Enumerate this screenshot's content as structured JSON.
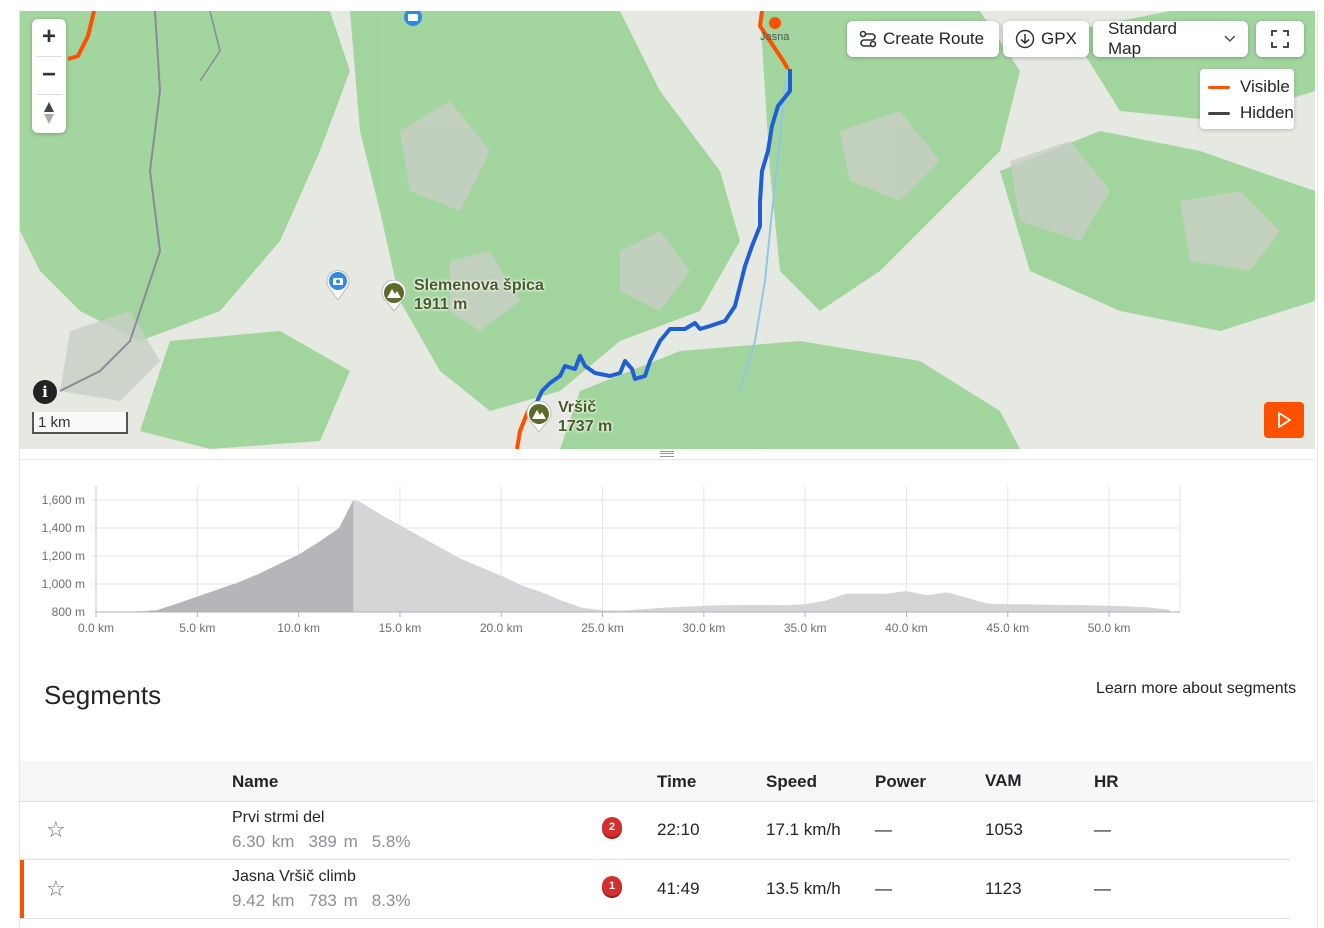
{
  "map": {
    "zoom_in": "+",
    "zoom_out": "−",
    "toolbar": {
      "create_route": "Create Route",
      "gpx": "GPX",
      "map_style": "Standard Map"
    },
    "legend": [
      {
        "label": "Visible",
        "color": "#fc5200"
      },
      {
        "label": "Hidden",
        "color": "#444444"
      }
    ],
    "scale_label": "1 km",
    "places": [
      {
        "name": "Slemenova špica",
        "elevation": "1911 m"
      },
      {
        "name": "Vršič",
        "elevation": "1737 m"
      },
      {
        "name": "Jasna"
      }
    ],
    "route_color": "#1f5fd6",
    "icons": [
      "plus-icon",
      "minus-icon",
      "compass-icon",
      "route-icon",
      "download-icon",
      "chevron-down-icon",
      "fullscreen-icon",
      "info-icon",
      "play-icon",
      "camera-icon",
      "mountain-icon"
    ]
  },
  "elevation": {
    "y_ticks": [
      "1,600 m",
      "1,400 m",
      "1,200 m",
      "1,000 m",
      "800 m"
    ],
    "x_ticks": [
      "0.0 km",
      "5.0 km",
      "10.0 km",
      "15.0 km",
      "20.0 km",
      "25.0 km",
      "30.0 km",
      "35.0 km",
      "40.0 km",
      "45.0 km",
      "50.0 km"
    ]
  },
  "chart_data": {
    "type": "area",
    "x": [
      0,
      1,
      2,
      3,
      4,
      5,
      6,
      7,
      8,
      9,
      10,
      11,
      12,
      12.7,
      13,
      14,
      15,
      16,
      17,
      18,
      19,
      20,
      21,
      22,
      23,
      24,
      25,
      26,
      27,
      28,
      29,
      30,
      31,
      32,
      33,
      34,
      35,
      36,
      37,
      38,
      39,
      40,
      41,
      42,
      43,
      44,
      45,
      46,
      47,
      48,
      49,
      50,
      51,
      52,
      53
    ],
    "y": [
      800,
      802,
      805,
      812,
      860,
      910,
      960,
      1010,
      1070,
      1140,
      1210,
      1300,
      1400,
      1600,
      1590,
      1500,
      1420,
      1340,
      1260,
      1180,
      1120,
      1060,
      990,
      940,
      880,
      830,
      812,
      810,
      820,
      830,
      838,
      845,
      848,
      850,
      850,
      848,
      855,
      880,
      930,
      930,
      930,
      950,
      920,
      940,
      900,
      860,
      855,
      855,
      852,
      850,
      848,
      845,
      840,
      832,
      815
    ],
    "highlight_x_range": [
      2.6,
      12.7
    ],
    "xlim": [
      0,
      53.5
    ],
    "ylim": [
      800,
      1600
    ],
    "xlabel": "",
    "ylabel": "",
    "grid": true
  },
  "segments": {
    "title": "Segments",
    "learn_more": "Learn more about segments",
    "columns": {
      "name": "Name",
      "time": "Time",
      "speed": "Speed",
      "power": "Power",
      "vam": "VAM",
      "hr": "HR"
    },
    "rows": [
      {
        "name": "Prvi strmi del",
        "distance": "6.30 km",
        "elev_gain": "389 m",
        "grade": "5.8%",
        "rank": "2",
        "time": "22:10",
        "speed": "17.1 km/h",
        "power": "—",
        "vam": "1053",
        "hr": "—",
        "selected": false
      },
      {
        "name": "Jasna Vršič climb",
        "distance": "9.42 km",
        "elev_gain": "783 m",
        "grade": "8.3%",
        "rank": "1",
        "time": "41:49",
        "speed": "13.5 km/h",
        "power": "—",
        "vam": "1123",
        "hr": "—",
        "selected": true
      }
    ]
  }
}
